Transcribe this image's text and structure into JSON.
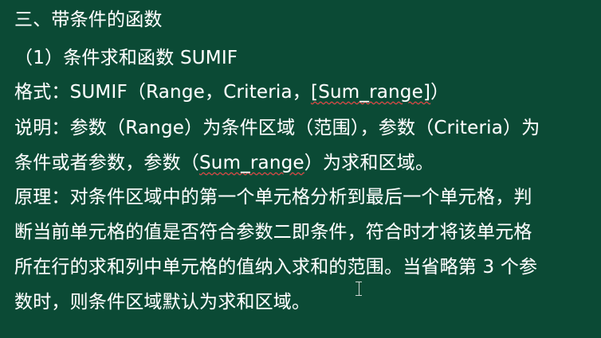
{
  "slide": {
    "line1": "三、带条件的函数",
    "line2": "（1）条件求和函数 SUMIF",
    "line3": {
      "prefix": "格式：SUMIF（Range，Criteria，",
      "underlined": "[Sum_range]",
      "suffix": "）"
    },
    "line4": "说明：参数（Range）为条件区域（范围），参数（Criteria）为",
    "line5": {
      "prefix": "条件或者参数，参数（",
      "underlined": "Sum_range",
      "suffix": "）为求和区域。"
    },
    "line6": "原理：对条件区域中的第一个单元格分析到最后一个单元格，判",
    "line7": "断当前单元格的值是否符合参数二即条件，符合时才将该单元格",
    "line8": "所在行的求和列中单元格的值纳入求和的范围。当省略第 3 个参",
    "line9": "数时，则条件区域默认为求和区域。"
  },
  "colors": {
    "background": "#0b4a35",
    "text": "#ffffff",
    "spellcheck_underline": "#ff3b3b"
  },
  "icons": {
    "cursor": "ibeam-cursor-icon"
  }
}
